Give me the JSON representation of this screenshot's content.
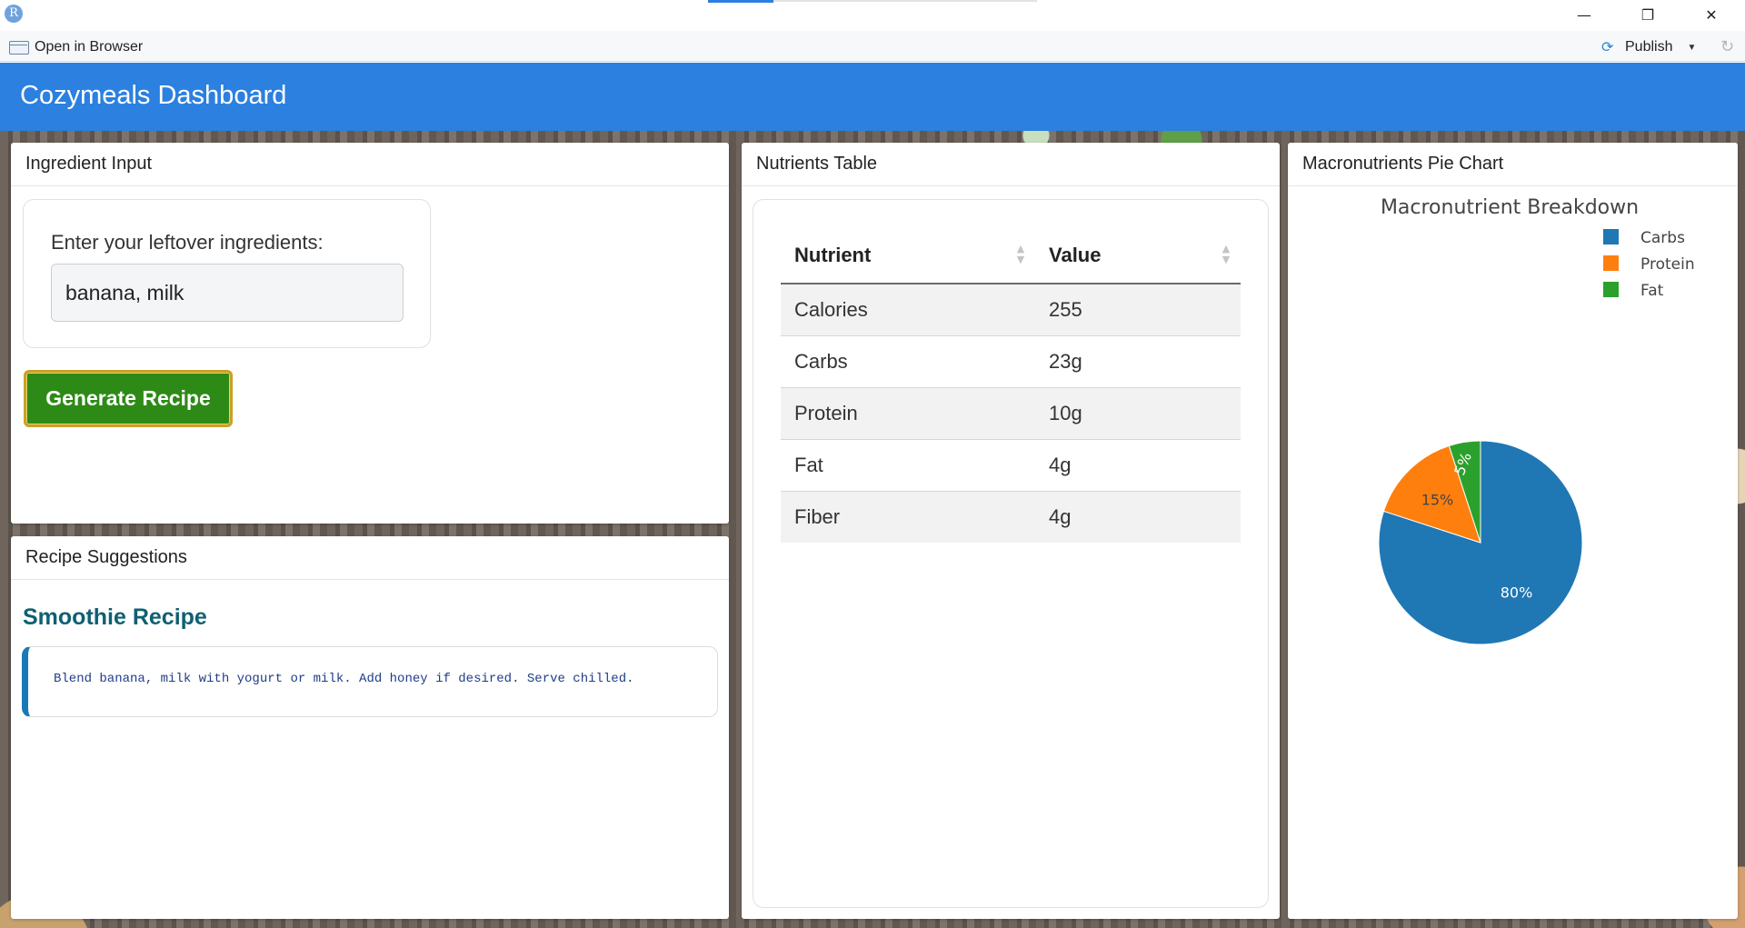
{
  "window": {
    "app_icon_letter": "R",
    "open_in_browser_label": "Open in Browser",
    "publish_label": "Publish",
    "minimize_icon": "minimize-icon",
    "restore_icon": "restore-icon",
    "close_icon": "close-icon"
  },
  "header": {
    "title": "Cozymeals Dashboard",
    "bg_color": "#2b80e0"
  },
  "ingredient_card": {
    "title": "Ingredient Input",
    "input_label": "Enter your leftover ingredients:",
    "input_value": "banana, milk",
    "button_label": "Generate Recipe",
    "button_color": "#2e8a17"
  },
  "recipe_card": {
    "title": "Recipe Suggestions",
    "recipe_title": "Smoothie Recipe",
    "recipe_text": "Blend banana, milk with yogurt or milk. Add honey if desired. Serve chilled."
  },
  "nutrients_card": {
    "title": "Nutrients Table",
    "columns": [
      "Nutrient",
      "Value"
    ],
    "rows": [
      [
        "Calories",
        "255"
      ],
      [
        "Carbs",
        "23g"
      ],
      [
        "Protein",
        "10g"
      ],
      [
        "Fat",
        "4g"
      ],
      [
        "Fiber",
        "4g"
      ]
    ]
  },
  "macros_card": {
    "title": "Macronutrients Pie Chart"
  },
  "chart_data": {
    "type": "pie",
    "title": "Macronutrient Breakdown",
    "categories": [
      "Carbs",
      "Protein",
      "Fat"
    ],
    "values": [
      80,
      15,
      5
    ],
    "labels": [
      "80%",
      "15%",
      "5%"
    ],
    "colors": [
      "#1f77b4",
      "#ff7f0e",
      "#2ca02c"
    ],
    "legend_position": "top-right"
  }
}
